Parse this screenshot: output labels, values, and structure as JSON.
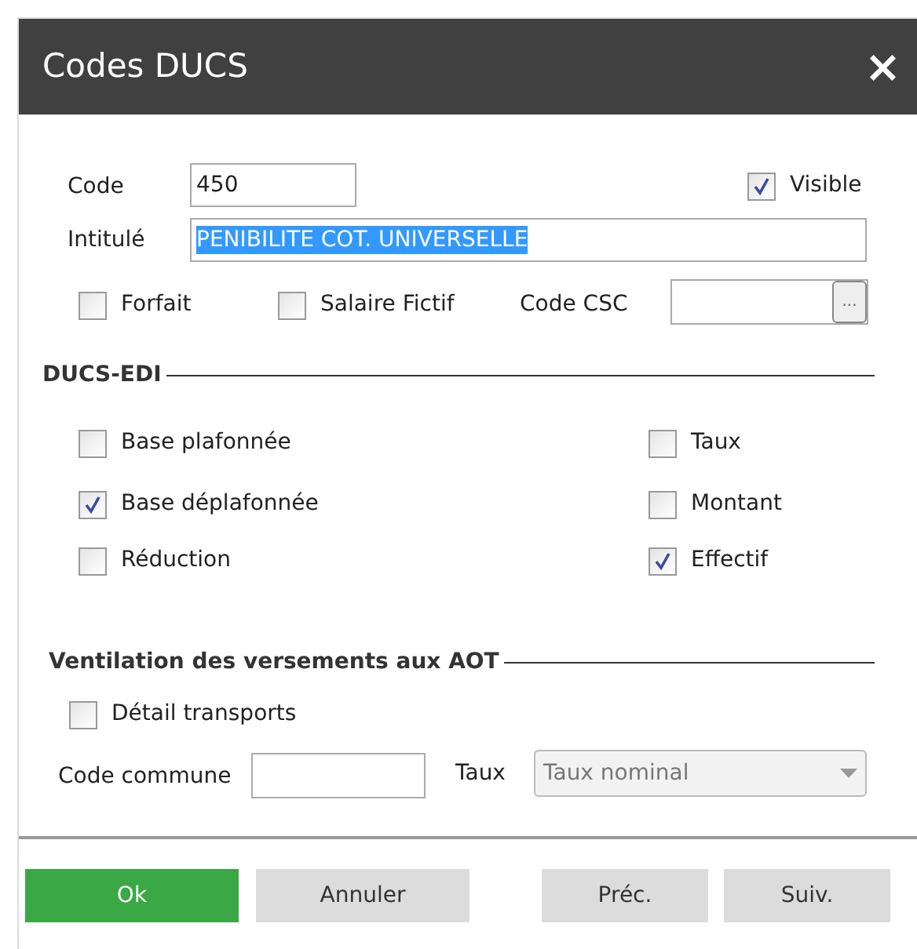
{
  "window": {
    "title": "Codes DUCS",
    "close": "×"
  },
  "code": {
    "label": "Code",
    "value": "450"
  },
  "visible": {
    "label": "Visible",
    "checked": true
  },
  "intitule": {
    "label": "Intitulé",
    "value": "PENIBILITE COT. UNIVERSELLE",
    "selected": true
  },
  "options": [
    {
      "label": "Forfait",
      "checked": false
    },
    {
      "label": "Salaire Fictif",
      "checked": false
    }
  ],
  "code_csc": {
    "label": "Code CSC",
    "button": "..."
  },
  "ducs_edi": {
    "title": "DUCS-EDI",
    "left": [
      {
        "label": "Base plafonnée",
        "checked": false
      },
      {
        "label": "Base déplafonnée",
        "checked": true
      },
      {
        "label": "Réduction",
        "checked": false
      }
    ],
    "right": [
      {
        "label": "Taux",
        "checked": false
      },
      {
        "label": "Montant",
        "checked": false
      },
      {
        "label": "Effectif",
        "checked": true
      }
    ]
  },
  "ventilation": {
    "title": "Ventilation des versements aux AOT",
    "detail": {
      "label": "Détail transports",
      "checked": false
    },
    "code_commune": {
      "label": "Code commune"
    },
    "taux": {
      "label": "Taux",
      "value": "Taux nominal",
      "disabled": true
    }
  },
  "buttons": [
    {
      "label": "Ok",
      "kind": "primary"
    },
    {
      "label": "Annuler",
      "kind": "secondary"
    },
    {
      "label": "Préc.",
      "kind": "secondary"
    },
    {
      "label": "Suiv.",
      "kind": "secondary"
    }
  ]
}
